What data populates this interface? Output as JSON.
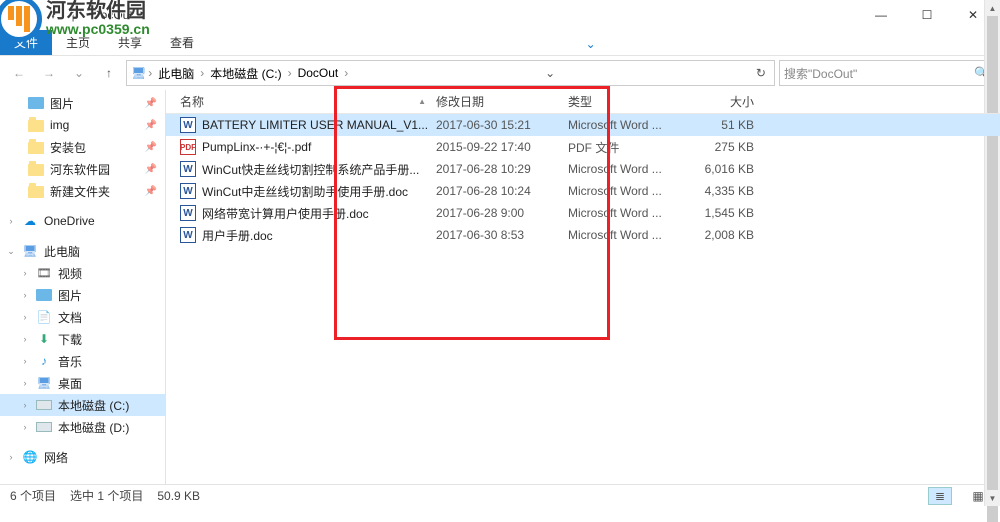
{
  "window": {
    "title": "DocOut",
    "controls": {
      "min": "—",
      "max": "☐",
      "close": "✕"
    }
  },
  "ribbon": {
    "file": "文件",
    "tabs": [
      "主页",
      "共享",
      "查看"
    ],
    "chevron": "⌄"
  },
  "nav": {
    "back": "←",
    "fwd": "→",
    "up": "↑"
  },
  "breadcrumb": {
    "items": [
      "此电脑",
      "本地磁盘 (C:)",
      "DocOut"
    ],
    "sep": "›",
    "dropdown": "⌄",
    "refresh": "↻"
  },
  "search": {
    "placeholder": "搜索\"DocOut\"",
    "icon": "🔍"
  },
  "sidebar": {
    "items": [
      {
        "label": "图片",
        "icon": "pic",
        "pin": true
      },
      {
        "label": "img",
        "icon": "folder",
        "pin": true
      },
      {
        "label": "安装包",
        "icon": "folder",
        "pin": true
      },
      {
        "label": "河东软件园",
        "icon": "folder",
        "pin": true
      },
      {
        "label": "新建文件夹",
        "icon": "folder",
        "pin": true
      }
    ],
    "onedrive": "OneDrive",
    "thispc": "此电脑",
    "pcitems": [
      {
        "label": "视频",
        "icon": "video"
      },
      {
        "label": "图片",
        "icon": "pic"
      },
      {
        "label": "文档",
        "icon": "doc"
      },
      {
        "label": "下载",
        "icon": "download"
      },
      {
        "label": "音乐",
        "icon": "music"
      },
      {
        "label": "桌面",
        "icon": "desktop"
      },
      {
        "label": "本地磁盘 (C:)",
        "icon": "drive",
        "selected": true
      },
      {
        "label": "本地磁盘 (D:)",
        "icon": "drive"
      }
    ],
    "network": "网络"
  },
  "columns": {
    "name": "名称",
    "date": "修改日期",
    "type": "类型",
    "size": "大小"
  },
  "files": [
    {
      "name": "BATTERY LIMITER USER MANUAL_V1...",
      "date": "2017-06-30 15:21",
      "type": "Microsoft Word ...",
      "size": "51 KB",
      "icon": "word",
      "selected": true
    },
    {
      "name": "PumpLinx-·+-¦€¦-.pdf",
      "date": "2015-09-22 17:40",
      "type": "PDF 文件",
      "size": "275 KB",
      "icon": "pdf"
    },
    {
      "name": "WinCut快走丝线切割控制系统产品手册...",
      "date": "2017-06-28 10:29",
      "type": "Microsoft Word ...",
      "size": "6,016 KB",
      "icon": "word"
    },
    {
      "name": "WinCut中走丝线切割助手使用手册.doc",
      "date": "2017-06-28 10:24",
      "type": "Microsoft Word ...",
      "size": "4,335 KB",
      "icon": "word"
    },
    {
      "name": "网络带宽计算用户使用手册.doc",
      "date": "2017-06-28 9:00",
      "type": "Microsoft Word ...",
      "size": "1,545 KB",
      "icon": "word"
    },
    {
      "name": "用户手册.doc",
      "date": "2017-06-30 8:53",
      "type": "Microsoft Word ...",
      "size": "2,008 KB",
      "icon": "word"
    }
  ],
  "status": {
    "count": "6 个项目",
    "selected": "选中 1 个项目",
    "size": "50.9 KB"
  },
  "watermark": {
    "cn": "河东软件园",
    "url": "www.pc0359.cn"
  },
  "icons": {
    "pin": "📌",
    "monitor": "🖥",
    "net": "🌐",
    "cloud": "☁",
    "vidglyph": "🎞",
    "docglyph": "📄",
    "dlglyph": "⬇",
    "musicglyph": "♪",
    "deskglyph": "🖥",
    "detailview": "≣",
    "iconview": "▦"
  }
}
